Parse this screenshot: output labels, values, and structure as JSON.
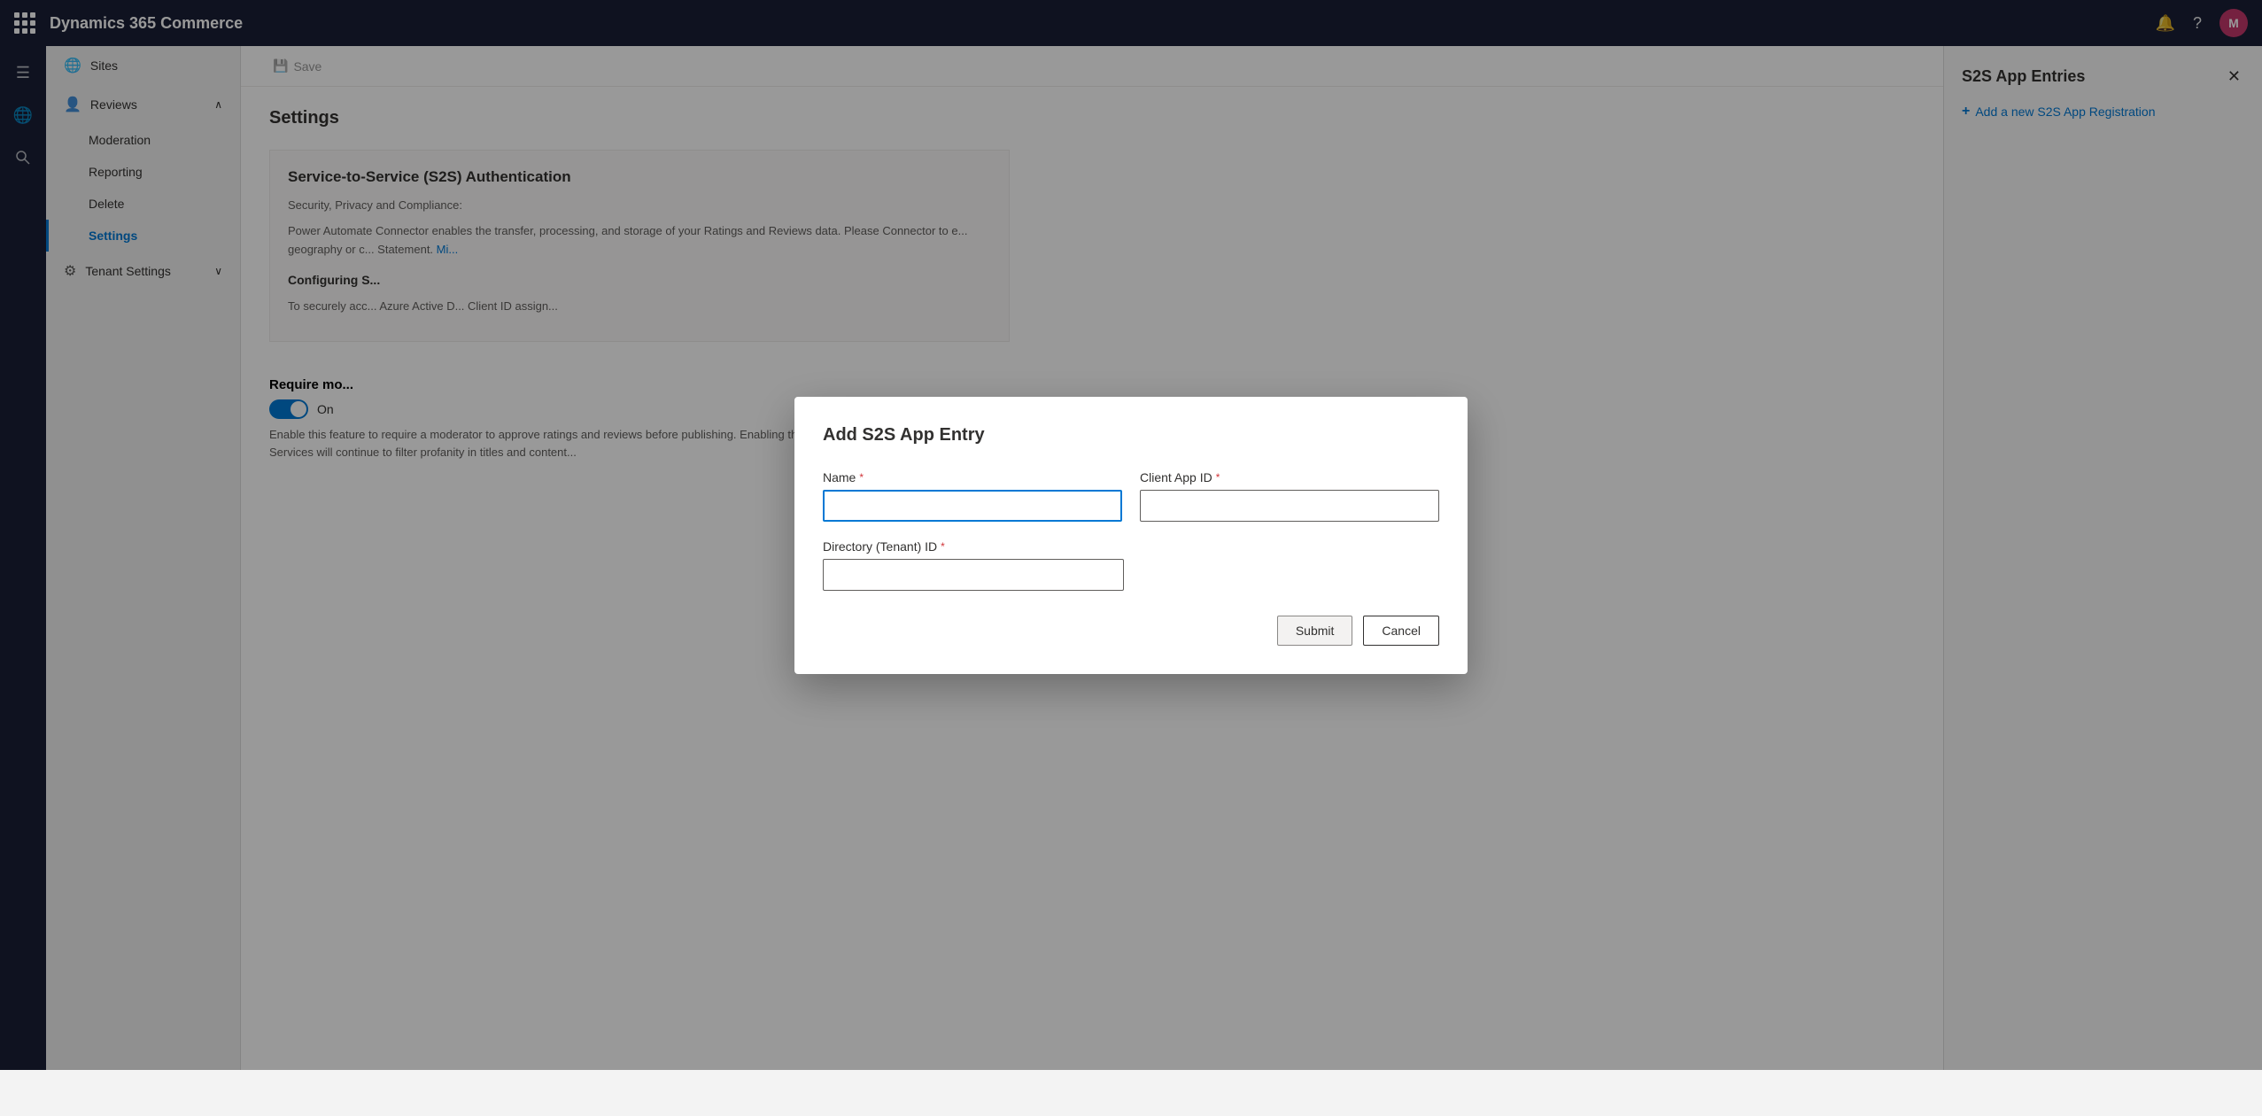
{
  "app": {
    "title": "Dynamics 365 Commerce"
  },
  "topbar": {
    "title": "Dynamics 365 Commerce",
    "avatar_label": "M",
    "avatar_color": "#c4376b"
  },
  "sidebar": {
    "sites_label": "Sites",
    "reviews_label": "Reviews",
    "moderation_label": "Moderation",
    "reporting_label": "Reporting",
    "delete_label": "Delete",
    "settings_label": "Settings",
    "tenant_settings_label": "Tenant Settings"
  },
  "toolbar": {
    "save_icon": "💾",
    "save_label": "Save"
  },
  "content": {
    "title": "Settings",
    "section_s2s_title": "Service-to-Service (S2S) Authentication",
    "section_s2s_subtitle": "Security, Privacy and Compliance:",
    "section_s2s_text": "Power Automate Connector enables the transfer, processing, and storage of your Ratings and Reviews data. Please Connector to e... geography or c... Statement. Mi...",
    "configuring_title": "Configuring S...",
    "configuring_text": "To securely acc... Azure Active D... Client ID assign...",
    "require_mod_title": "Require mo...",
    "toggle_label": "On",
    "enable_text": "Enable this feature to require a moderator to approve ratings and reviews before publishing. Enabling this feature publishing. Azure Cognitive Services will continue to filter profanity in titles and content..."
  },
  "right_panel": {
    "title": "S2S App Entries",
    "add_label": "Add a new S2S App Registration",
    "close_icon": "✕"
  },
  "modal": {
    "title": "Add S2S App Entry",
    "name_label": "Name",
    "name_required": "*",
    "client_app_id_label": "Client App ID",
    "client_app_id_required": "*",
    "directory_tenant_id_label": "Directory (Tenant) ID",
    "directory_required": "*",
    "submit_label": "Submit",
    "cancel_label": "Cancel"
  }
}
